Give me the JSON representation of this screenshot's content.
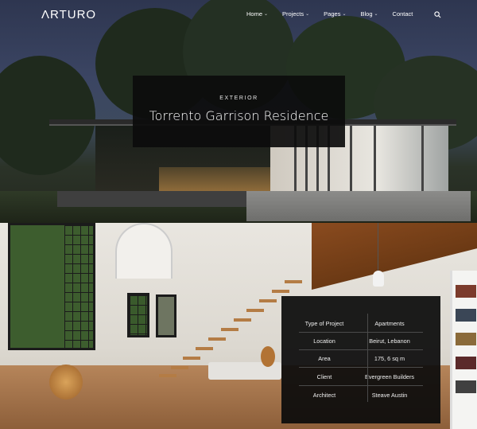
{
  "brand": {
    "logo_a": "Λ",
    "logo_rest": "RTURO"
  },
  "nav": {
    "items": [
      {
        "label": "Home",
        "has_dropdown": true
      },
      {
        "label": "Projects",
        "has_dropdown": true
      },
      {
        "label": "Pages",
        "has_dropdown": true
      },
      {
        "label": "Blog",
        "has_dropdown": true
      },
      {
        "label": "Contact",
        "has_dropdown": false
      }
    ],
    "dropdown_glyph": "⌄",
    "search_icon": "search-icon"
  },
  "hero": {
    "category": "EXTERIOR",
    "title": "Torrento Garrison Residence"
  },
  "project_info": {
    "rows": [
      {
        "key": "Type of Project",
        "value": "Apartments"
      },
      {
        "key": "Location",
        "value": "Beirut, Lebanon"
      },
      {
        "key": "Area",
        "value": "175, 6 sq m"
      },
      {
        "key": "Client",
        "value": "Evergreen Builders"
      },
      {
        "key": "Architect",
        "value": "Steave Austin"
      }
    ]
  },
  "colors": {
    "overlay": "#0c0c0c",
    "text": "#ffffff",
    "wood": "#b47c45"
  }
}
